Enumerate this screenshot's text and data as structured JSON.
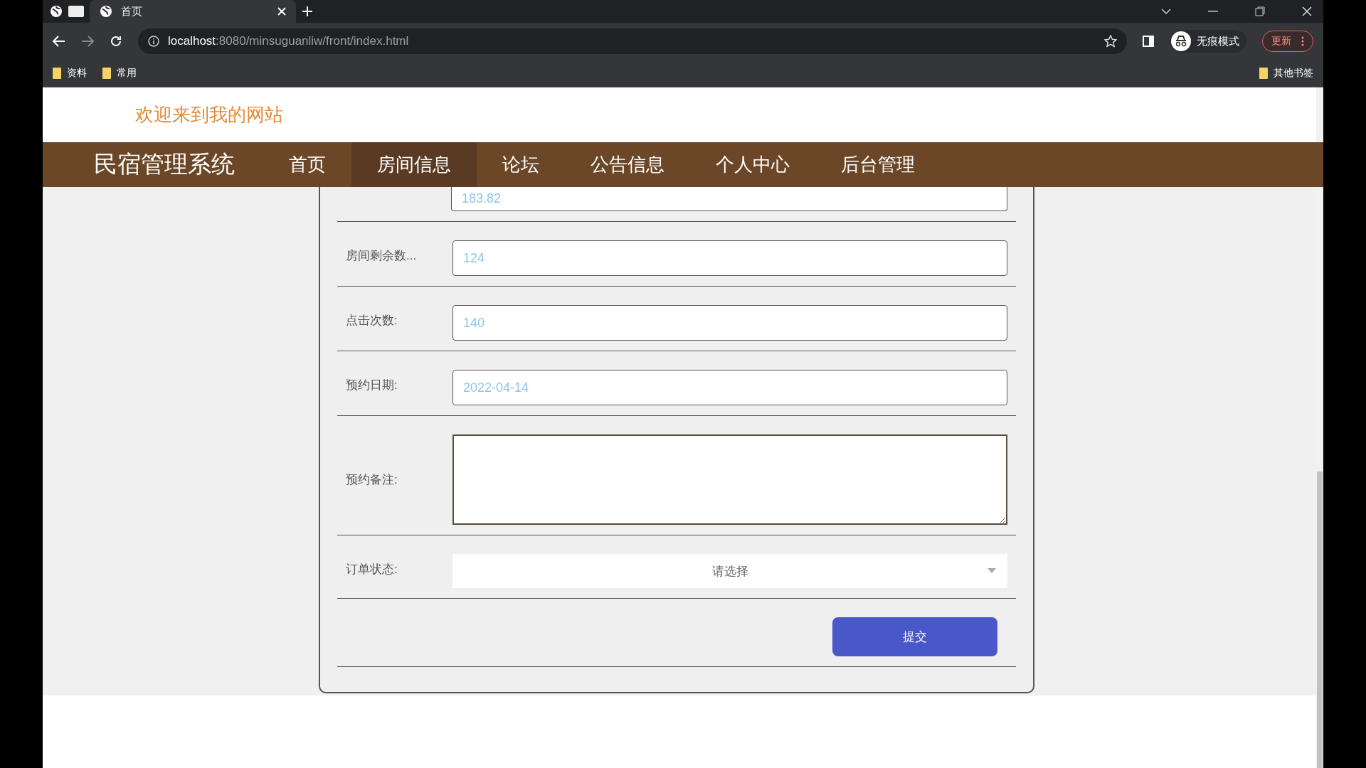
{
  "browser": {
    "tabs": [
      {
        "title": "首页",
        "selected": true
      }
    ],
    "url_host": "localhost",
    "url_rest": ":8080/minsuguanliw/front/index.html",
    "profile": "无痕模式",
    "update_button": "更新",
    "bookmarks": [
      "资料",
      "常用"
    ],
    "other_bookmarks": "其他书签"
  },
  "site": {
    "welcome": "欢迎来到我的网站",
    "brand": "民宿管理系统",
    "nav": [
      {
        "label": "首页",
        "selected": false
      },
      {
        "label": "房间信息",
        "selected": true
      },
      {
        "label": "论坛",
        "selected": false
      },
      {
        "label": "公告信息",
        "selected": false
      },
      {
        "label": "个人中心",
        "selected": false
      },
      {
        "label": "后台管理",
        "selected": false
      }
    ]
  },
  "form": {
    "fields": [
      {
        "kind": "cut",
        "value": "183.82"
      },
      {
        "kind": "input",
        "label": "房间剩余数...",
        "value": "124"
      },
      {
        "kind": "input",
        "label": "点击次数:",
        "value": "140"
      },
      {
        "kind": "input",
        "label": "预约日期:",
        "value": "2022-04-14"
      },
      {
        "kind": "textarea",
        "label": "预约备注:"
      },
      {
        "kind": "select",
        "label": "订单状态:",
        "placeholder": "请选择"
      }
    ],
    "submit": "提交"
  }
}
